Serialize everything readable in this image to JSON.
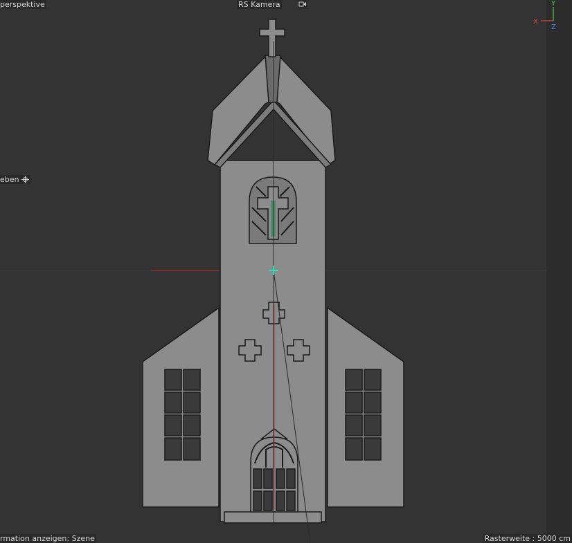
{
  "viewport": {
    "view_label": "perspektive",
    "camera_label": "RS Kamera",
    "move_label": "eben",
    "info_label": "rmation anzeigen: Szene",
    "grid_label": "Rasterweite : 5000 cm"
  },
  "axis_gizmo": {
    "x_label": "X",
    "y_label": "Y",
    "z_label": "Z",
    "x_color": "#e04040",
    "y_color": "#50d050",
    "z_color": "#4a7ee8"
  },
  "icons": {
    "camera_lock": "camera-lock-icon",
    "move": "move-cross-icon"
  },
  "colors": {
    "background": "#333333",
    "model": "#8c8c8c",
    "pivot": "#30e0b0"
  }
}
